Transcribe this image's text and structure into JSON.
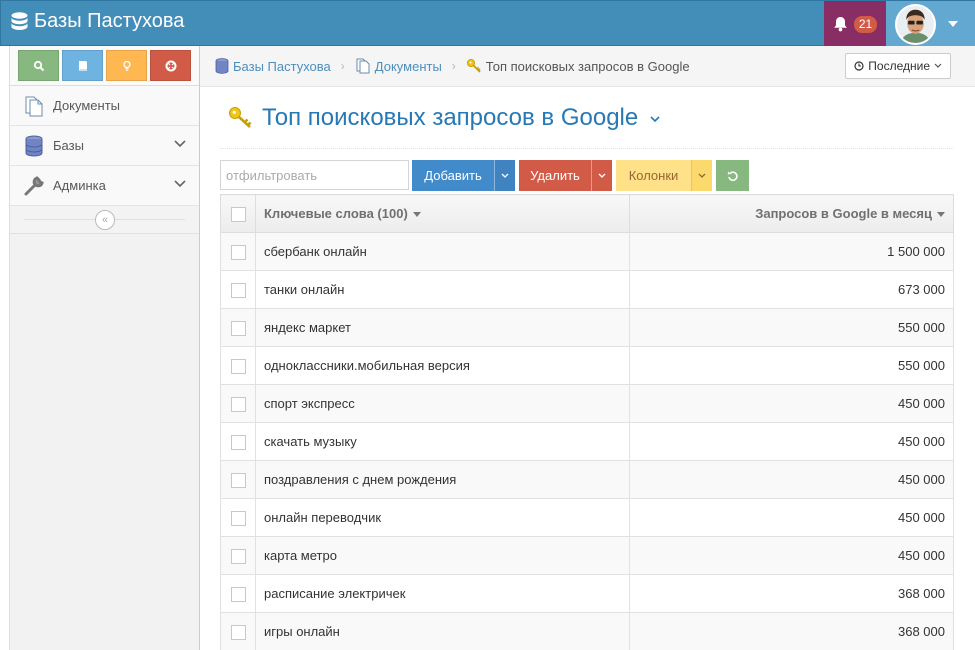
{
  "app": {
    "brand": "Базы Пастухова"
  },
  "header": {
    "notifications_count": "21"
  },
  "sidebar": {
    "shortcuts": [
      {
        "icon": "search-icon",
        "color": "#87b87f"
      },
      {
        "icon": "book-icon",
        "color": "#6fb3e0"
      },
      {
        "icon": "lightbulb-icon",
        "color": "#ffb752"
      },
      {
        "icon": "lifebuoy-icon",
        "color": "#d15b47"
      }
    ],
    "items": [
      {
        "label": "Документы",
        "icon": "documents-icon"
      },
      {
        "label": "Базы",
        "icon": "database-icon"
      },
      {
        "label": "Админка",
        "icon": "wrench-icon"
      }
    ]
  },
  "breadcrumbs": {
    "items": [
      "Базы Пастухова",
      "Документы",
      "Топ поисковых запросов в Google"
    ],
    "recent_label": "Последние"
  },
  "page": {
    "title": "Топ поисковых запросов в Google"
  },
  "toolbar": {
    "filter_placeholder": "отфильтровать",
    "add_label": "Добавить",
    "delete_label": "Удалить",
    "columns_label": "Колонки"
  },
  "table": {
    "columns": [
      "Ключевые слова (100)",
      "Запросов в Google в месяц"
    ],
    "rows": [
      {
        "keyword": "сбербанк онлайн",
        "queries": "1 500 000"
      },
      {
        "keyword": "танки онлайн",
        "queries": "673 000"
      },
      {
        "keyword": "яндекс маркет",
        "queries": "550 000"
      },
      {
        "keyword": "одноклассники.мобильная версия",
        "queries": "550 000"
      },
      {
        "keyword": "спорт экспресс",
        "queries": "450 000"
      },
      {
        "keyword": "скачать музыку",
        "queries": "450 000"
      },
      {
        "keyword": "поздравления с днем рождения",
        "queries": "450 000"
      },
      {
        "keyword": "онлайн переводчик",
        "queries": "450 000"
      },
      {
        "keyword": "карта метро",
        "queries": "450 000"
      },
      {
        "keyword": "расписание электричек",
        "queries": "368 000"
      },
      {
        "keyword": "игры онлайн",
        "queries": "368 000"
      }
    ]
  }
}
